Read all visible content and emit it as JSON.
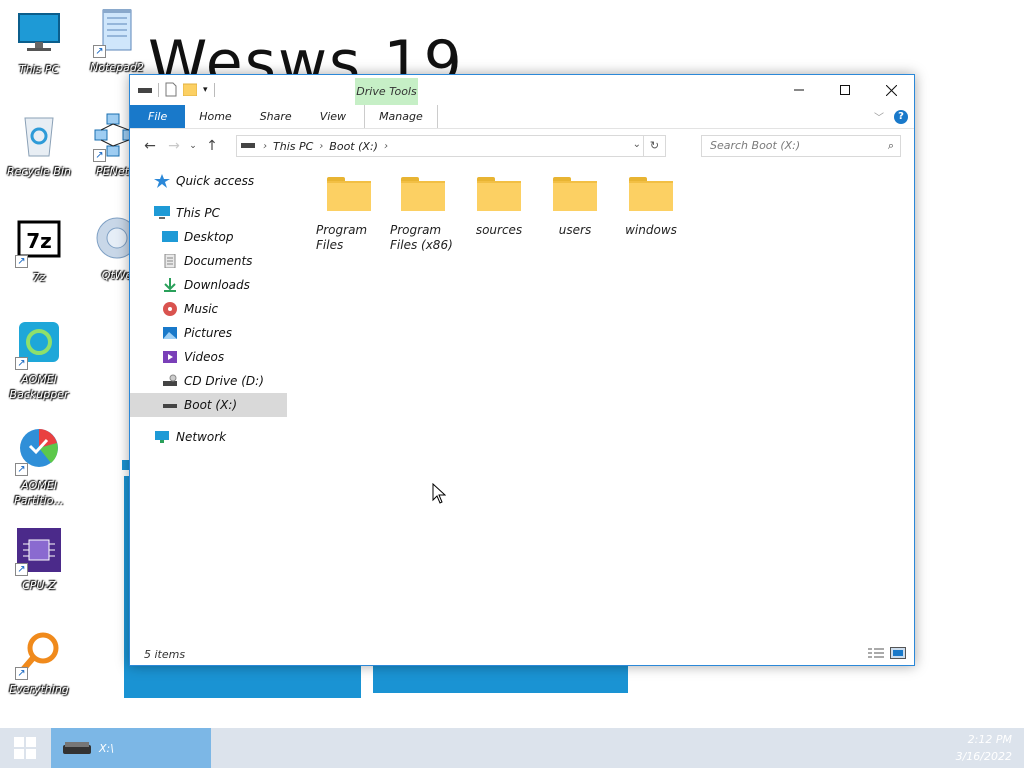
{
  "desktop": {
    "wallpaper_text": "Wesws 19",
    "icons": [
      {
        "label": "This PC"
      },
      {
        "label": "Notepad2"
      },
      {
        "label": "Recycle Bin"
      },
      {
        "label": "PENetw"
      },
      {
        "label": "7z"
      },
      {
        "label": "QtWe"
      },
      {
        "label": "AOMEI Backupper"
      },
      {
        "label": "AOMEI Partitio..."
      },
      {
        "label": "CPU-Z"
      },
      {
        "label": "Everything"
      }
    ]
  },
  "explorer": {
    "ribbon": {
      "context_tab": "Drive Tools",
      "tabs": [
        "File",
        "Home",
        "Share",
        "View",
        "Manage"
      ]
    },
    "address": {
      "crumbs": [
        "This PC",
        "Boot (X:)"
      ]
    },
    "search": {
      "placeholder": "Search Boot (X:)"
    },
    "nav_pane": {
      "items": [
        {
          "label": "Quick access",
          "icon": "star-icon"
        },
        {
          "label": "This PC",
          "icon": "computer-icon"
        },
        {
          "label": "Desktop",
          "icon": "desktop-icon"
        },
        {
          "label": "Documents",
          "icon": "documents-icon"
        },
        {
          "label": "Downloads",
          "icon": "download-icon"
        },
        {
          "label": "Music",
          "icon": "music-icon"
        },
        {
          "label": "Pictures",
          "icon": "pictures-icon"
        },
        {
          "label": "Videos",
          "icon": "videos-icon"
        },
        {
          "label": "CD Drive (D:)",
          "icon": "cd-drive-icon"
        },
        {
          "label": "Boot (X:)",
          "icon": "drive-icon"
        },
        {
          "label": "Network",
          "icon": "network-icon"
        }
      ],
      "selected": "Boot (X:)"
    },
    "folders": [
      {
        "name": "Program Files"
      },
      {
        "name": "Program Files (x86)"
      },
      {
        "name": "sources"
      },
      {
        "name": "users"
      },
      {
        "name": "windows"
      }
    ],
    "status": {
      "item_count": "5 items"
    }
  },
  "taskbar": {
    "active_item": "X:\\",
    "clock": {
      "time": "2:12 PM",
      "date": "3/16/2022"
    }
  },
  "colors": {
    "accent": "#1979ca",
    "wallpaper_tile": "#1a93d3",
    "context_tab": "#c6efc6",
    "taskbar": "#dce3ec",
    "taskbar_active": "#7cb7e6",
    "folder": "#fcd063"
  }
}
